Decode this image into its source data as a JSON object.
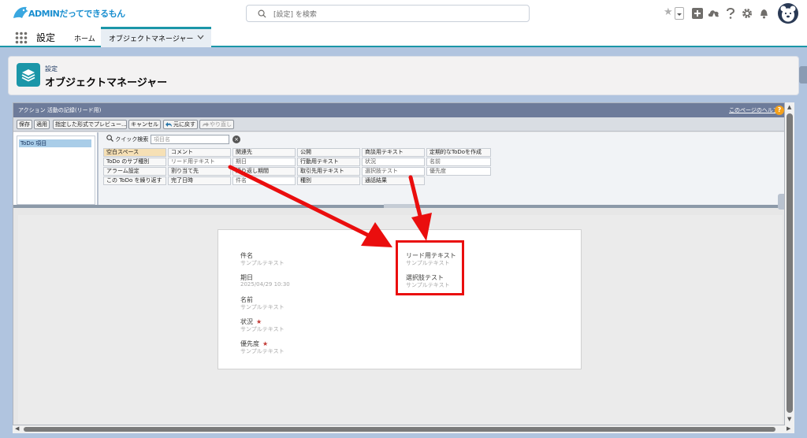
{
  "header": {
    "logo_text": "ADMINだってできるもん",
    "search_placeholder": "[設定] を検索",
    "brand_color": "#1b96a8"
  },
  "nav": {
    "app_name": "設定",
    "home": "ホーム",
    "active_tab": "オブジェクトマネージャー"
  },
  "page": {
    "breadcrumb": "設定",
    "title": "オブジェクトマネージャー"
  },
  "editor": {
    "title": "アクション 活動の記録(リード用)",
    "help_link": "このページのヘルプ",
    "toolbar": {
      "save": "保存",
      "apply": "適用",
      "preview": "指定した形式でプレビュー...",
      "cancel": "キャンセル",
      "undo": "元に戻す",
      "redo": "やり直し"
    },
    "categories": [
      "ToDo 項目"
    ],
    "quick_find_label": "クイック検索",
    "quick_find_placeholder": "項目名",
    "palette": [
      [
        "空白スペース",
        "コメント",
        "関連先",
        "公開",
        "商談用テキスト",
        "定期的なToDoを作成"
      ],
      [
        "ToDo のサブ種別",
        "リード用テキスト",
        "期日",
        "行動用テキスト",
        "状況",
        "名前"
      ],
      [
        "アラーム設定",
        "割り当て先",
        "繰り返し期間",
        "取引先用テキスト",
        "選択肢テスト",
        "優先度"
      ],
      [
        "この ToDo を繰り返す",
        "完了日時",
        "件名",
        "種別",
        "通話結果",
        ""
      ]
    ],
    "layout_fields_left": [
      {
        "label": "件名",
        "value": "サンプルテキスト",
        "required": false
      },
      {
        "label": "期日",
        "value": "2025/04/29 10:30",
        "required": false
      },
      {
        "label": "名前",
        "value": "サンプルテキスト",
        "required": false
      },
      {
        "label": "状況",
        "value": "サンプルテキスト",
        "required": true
      },
      {
        "label": "優先度",
        "value": "サンプルテキスト",
        "required": true
      }
    ],
    "layout_fields_right": [
      {
        "label": "リード用テキスト",
        "value": "サンプルテキスト"
      },
      {
        "label": "選択肢テスト",
        "value": "サンプルテキスト"
      }
    ],
    "required_mark": "★"
  },
  "annotation": {
    "color": "#ea0e0e"
  }
}
